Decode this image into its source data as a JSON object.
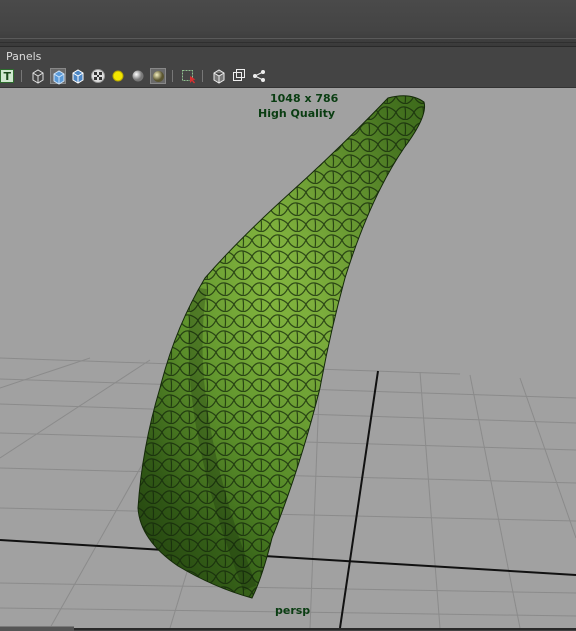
{
  "menubar": {
    "panels_label": "Panels"
  },
  "toolbar": {
    "icons": [
      "text-toggle-icon",
      "wireframe-cube-icon",
      "smooth-shade-cube-icon",
      "shaded-wireframe-cube-icon",
      "textured-checker-icon",
      "default-light-icon",
      "use-all-lights-icon",
      "shadows-icon",
      "xray-select-icon",
      "isolate-select-icon",
      "frame-cube-icon",
      "multi-view-icon",
      "node-graph-icon"
    ],
    "text_icon_glyph": "T"
  },
  "viewport": {
    "resolution": "1048 x 786",
    "quality": "High Quality",
    "camera": "persp"
  },
  "colors": {
    "viewport_bg": "#a1a1a1",
    "grid_line": "#8b8b8b",
    "axis_line": "#111111",
    "hud_text": "#0a3d12",
    "leaf_green": "#3f6e1c"
  }
}
